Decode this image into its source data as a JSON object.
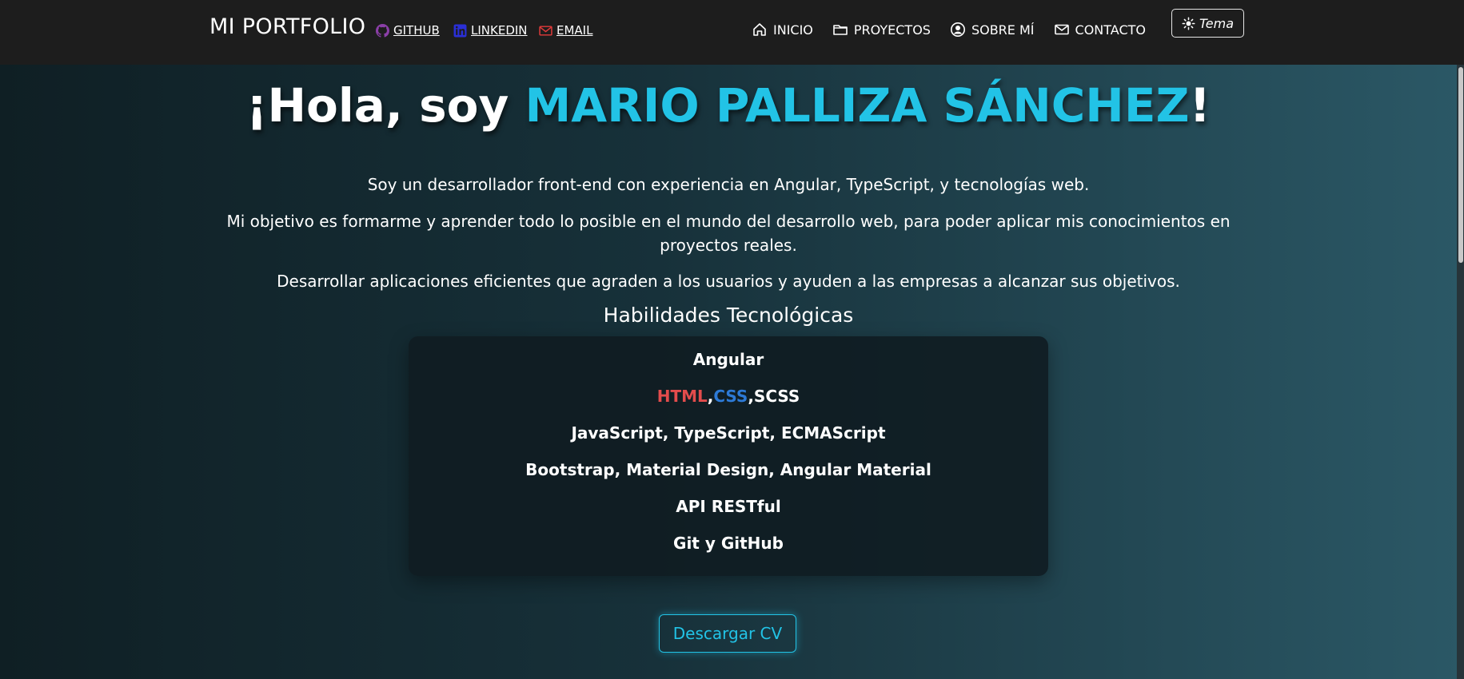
{
  "navbar": {
    "brand": "MI PORTFOLIO",
    "social": [
      {
        "label": "GITHUB",
        "icon": "github-icon",
        "color": "#8b3fa8"
      },
      {
        "label": "LINKEDIN",
        "icon": "linkedin-icon",
        "color": "#2a2fd6"
      },
      {
        "label": "EMAIL",
        "icon": "mail-icon",
        "color": "#e03a3a"
      }
    ],
    "links": [
      {
        "label": "INICIO",
        "icon": "home-icon"
      },
      {
        "label": "PROYECTOS",
        "icon": "folder-icon"
      },
      {
        "label": "SOBRE MÍ",
        "icon": "user-circle-icon"
      },
      {
        "label": "CONTACTO",
        "icon": "envelope-icon"
      }
    ],
    "theme_label": "Tema",
    "theme_icon": "sun-icon"
  },
  "hero": {
    "greeting": "¡Hola, soy ",
    "name": "MARIO PALLIZA SÁNCHEZ",
    "exclaim": "!",
    "name_color": "#22c3e6",
    "paragraphs": [
      "Soy un desarrollador front-end con experiencia en Angular, TypeScript, y tecnologías web.",
      "Mi objetivo es formarme y aprender todo lo posible en el mundo del desarrollo web, para poder aplicar mis conocimientos en proyectos reales.",
      "Desarrollar aplicaciones eficientes que agraden a los usuarios y ayuden a las empresas a alcanzar sus objetivos."
    ]
  },
  "skills": {
    "title": "Habilidades Tecnológicas",
    "items": [
      "Angular",
      {
        "html": "HTML",
        "sep1": ",",
        "css": "CSS",
        "sep2": ",",
        "scss": "SCSS"
      },
      "JavaScript, TypeScript, ECMAScript",
      "Bootstrap, Material Design, Angular Material",
      "API RESTful",
      "Git y GitHub"
    ]
  },
  "cv_button": "Descargar CV"
}
